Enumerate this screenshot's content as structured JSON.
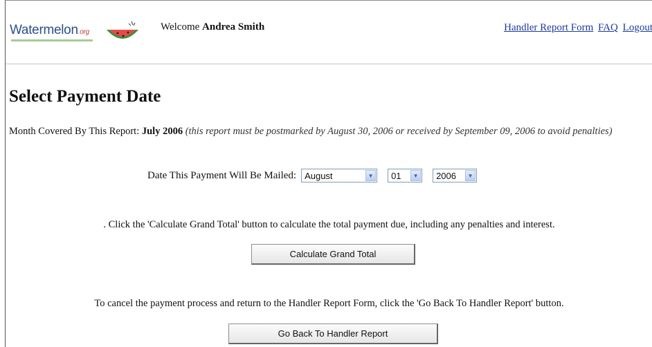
{
  "header": {
    "logo": {
      "text": "Watermelon",
      "suffix": ".org"
    },
    "welcome_prefix": "Welcome",
    "user_name": "Andrea Smith",
    "links": {
      "handler_report_form": "Handler Report Form",
      "faq": "FAQ",
      "logout": "Logout"
    }
  },
  "main": {
    "title": "Select Payment Date",
    "month_label": "Month Covered By This Report:",
    "month_value": "July 2006",
    "postmark_note": "(this report must be postmarked by August 30, 2006 or received by September 09, 2006 to avoid penalties)",
    "mail_date_label": "Date This Payment Will Be Mailed:",
    "mail_date": {
      "month": "August",
      "day": "01",
      "year": "2006"
    },
    "calculate_instruction": ". Click the 'Calculate Grand Total' button to calculate the total payment due, including any penalties and interest.",
    "calculate_button": "Calculate Grand Total",
    "cancel_instruction": "To cancel the payment process and return to the Handler Report Form, click the 'Go Back To Handler Report' button.",
    "back_button": "Go Back To Handler Report"
  },
  "colors": {
    "link": "#1a3c9c",
    "logo_text": "#2b4f8c",
    "logo_accent": "#c23a3a",
    "select_border": "#7f9db9"
  },
  "icons": {
    "logo_graphic": "watermelon-slice-icon",
    "dropdown": "chevron-down-icon"
  }
}
